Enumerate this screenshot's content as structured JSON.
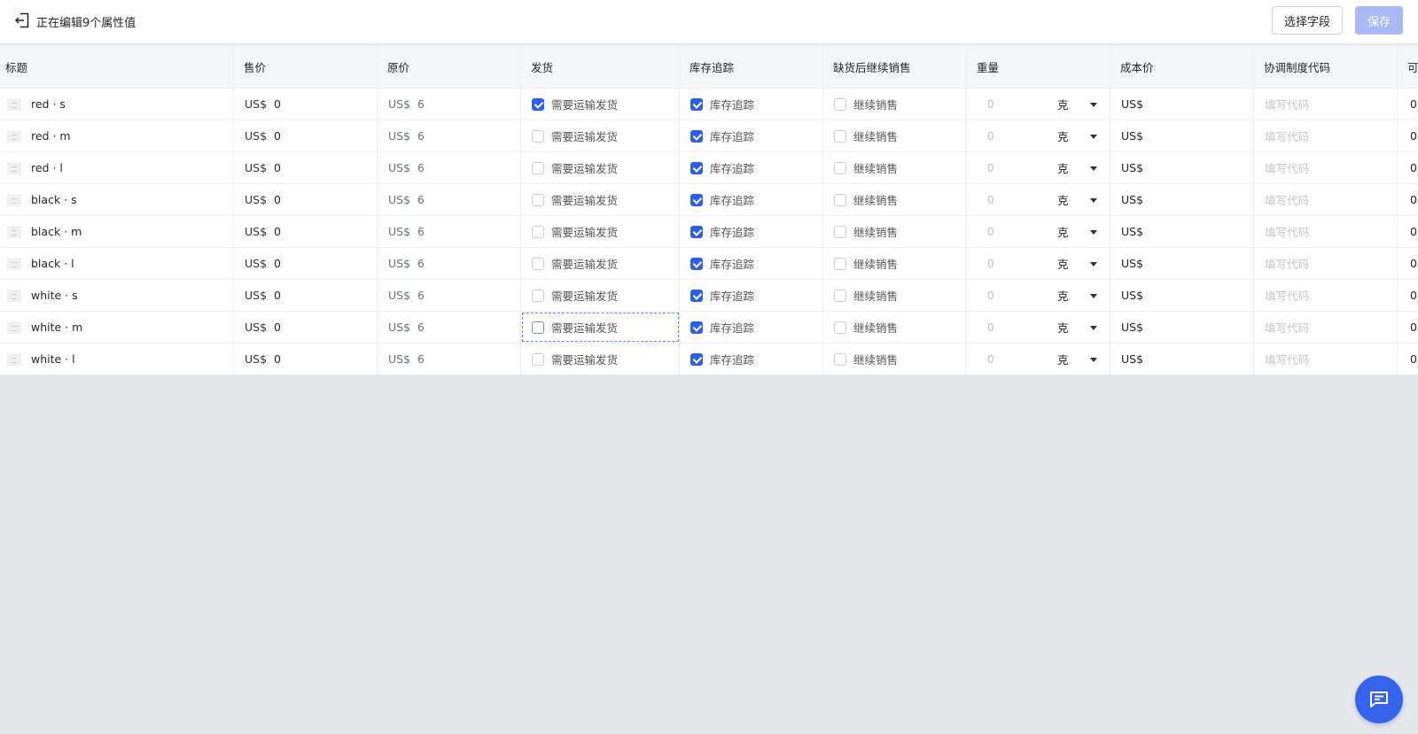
{
  "topbar": {
    "title": "正在编辑9个属性值",
    "select_fields_label": "选择字段",
    "save_label": "保存"
  },
  "table": {
    "headers": [
      "标题",
      "售价",
      "原价",
      "发货",
      "库存追踪",
      "缺货后继续销售",
      "重量",
      "成本价",
      "协调制度代码",
      "可售"
    ],
    "currency": "US$",
    "shipping_label": "需要运输发货",
    "tracking_label": "库存追踪",
    "continue_label": "继续销售",
    "weight_unit": "克",
    "hs_placeholder": "填写代码",
    "rows": [
      {
        "title": "red · s",
        "price": "0",
        "compare": "6",
        "shipping": true,
        "tracking": true,
        "continue": false,
        "weight": "0",
        "available": "0"
      },
      {
        "title": "red · m",
        "price": "0",
        "compare": "6",
        "shipping": false,
        "tracking": true,
        "continue": false,
        "weight": "0",
        "available": "0"
      },
      {
        "title": "red · l",
        "price": "0",
        "compare": "6",
        "shipping": false,
        "tracking": true,
        "continue": false,
        "weight": "0",
        "available": "0"
      },
      {
        "title": "black · s",
        "price": "0",
        "compare": "6",
        "shipping": false,
        "tracking": true,
        "continue": false,
        "weight": "0",
        "available": "0"
      },
      {
        "title": "black · m",
        "price": "0",
        "compare": "6",
        "shipping": false,
        "tracking": true,
        "continue": false,
        "weight": "0",
        "available": "0"
      },
      {
        "title": "black · l",
        "price": "0",
        "compare": "6",
        "shipping": false,
        "tracking": true,
        "continue": false,
        "weight": "0",
        "available": "0"
      },
      {
        "title": "white · s",
        "price": "0",
        "compare": "6",
        "shipping": false,
        "tracking": true,
        "continue": false,
        "weight": "0",
        "available": "0"
      },
      {
        "title": "white · m",
        "price": "0",
        "compare": "6",
        "shipping": false,
        "tracking": true,
        "continue": false,
        "weight": "0",
        "available": "0"
      },
      {
        "title": "white · l",
        "price": "0",
        "compare": "6",
        "shipping": false,
        "tracking": true,
        "continue": false,
        "weight": "0",
        "available": "0"
      }
    ]
  },
  "colors": {
    "accent": "#2f5ef5",
    "save_disabled": "#a8b9f5",
    "page_bg": "#e6e8ec"
  },
  "icons": {
    "back": "exit-back-icon",
    "thumbnail": "image-placeholder-icon",
    "dropdown": "caret-down-icon",
    "chat": "chat-message-icon"
  }
}
